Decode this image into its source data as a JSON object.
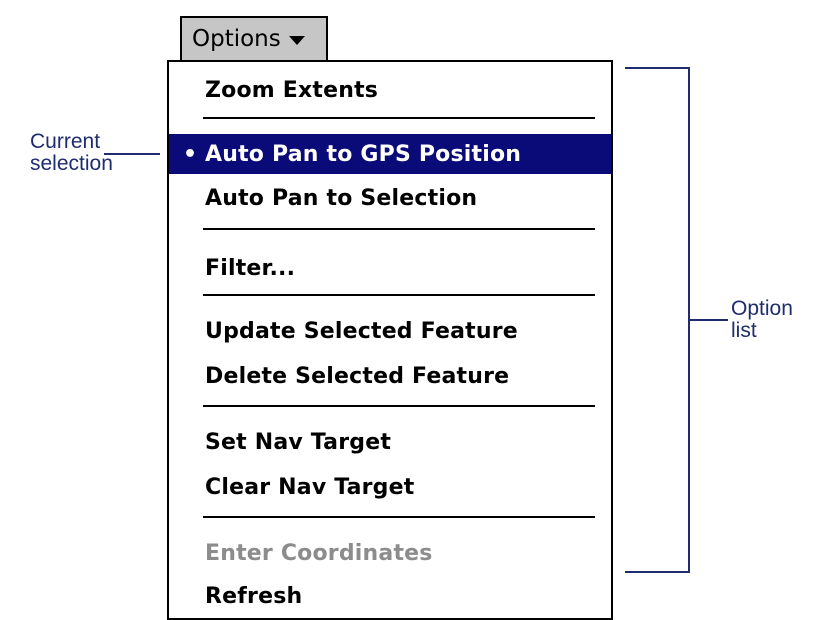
{
  "menu_button": {
    "label": "Options"
  },
  "menu": {
    "items": [
      {
        "label": "Zoom Extents"
      },
      {
        "label": "Auto Pan to GPS Position",
        "selected_marker": "•"
      },
      {
        "label": "Auto Pan to Selection"
      },
      {
        "label": "Filter..."
      },
      {
        "label": "Update Selected Feature"
      },
      {
        "label": "Delete Selected Feature"
      },
      {
        "label": "Set Nav Target"
      },
      {
        "label": "Clear Nav Target"
      },
      {
        "label": "Enter Coordinates"
      },
      {
        "label": "Refresh"
      }
    ]
  },
  "callouts": {
    "current_selection": {
      "line1": "Current",
      "line2": "selection"
    },
    "option_list": {
      "line1": "Option",
      "line2": "list"
    }
  },
  "colors": {
    "selection_bg": "#0a0a78",
    "callout": "#1f2d6e",
    "button_bg": "#c6c6c6",
    "disabled_text": "#8c8c8c"
  }
}
